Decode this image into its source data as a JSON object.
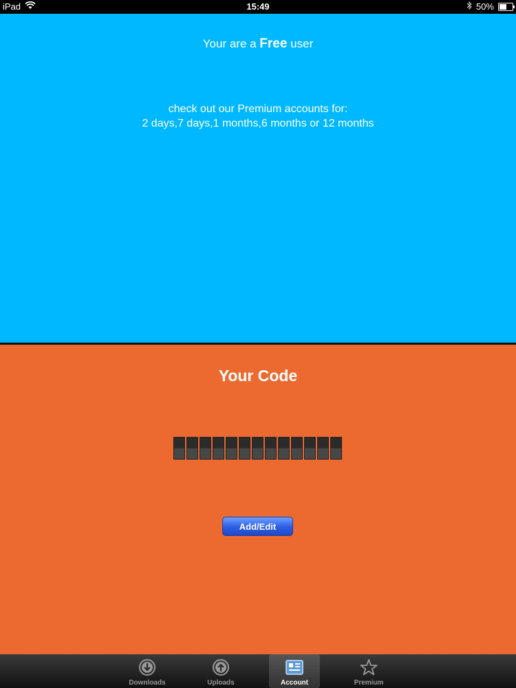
{
  "status_bar": {
    "device": "iPad",
    "time": "15:49",
    "battery": "50%"
  },
  "account": {
    "user_prefix": "Your are a ",
    "user_type": "Free",
    "user_suffix": " user",
    "premium_line1": "check out our Premium accounts for:",
    "premium_line2": "2 days,7 days,1 months,6 months or 12 months"
  },
  "code": {
    "title": "Your Code",
    "slots": 13,
    "button_label": "Add/Edit"
  },
  "tabs": [
    {
      "label": "Downloads",
      "icon": "download-icon",
      "active": false
    },
    {
      "label": "Uploads",
      "icon": "upload-icon",
      "active": false
    },
    {
      "label": "Account",
      "icon": "account-icon",
      "active": true
    },
    {
      "label": "Premium",
      "icon": "star-icon",
      "active": false
    }
  ],
  "colors": {
    "top_panel": "#00b8ff",
    "bottom_panel": "#ec6a30",
    "button": "#2b5de3"
  }
}
